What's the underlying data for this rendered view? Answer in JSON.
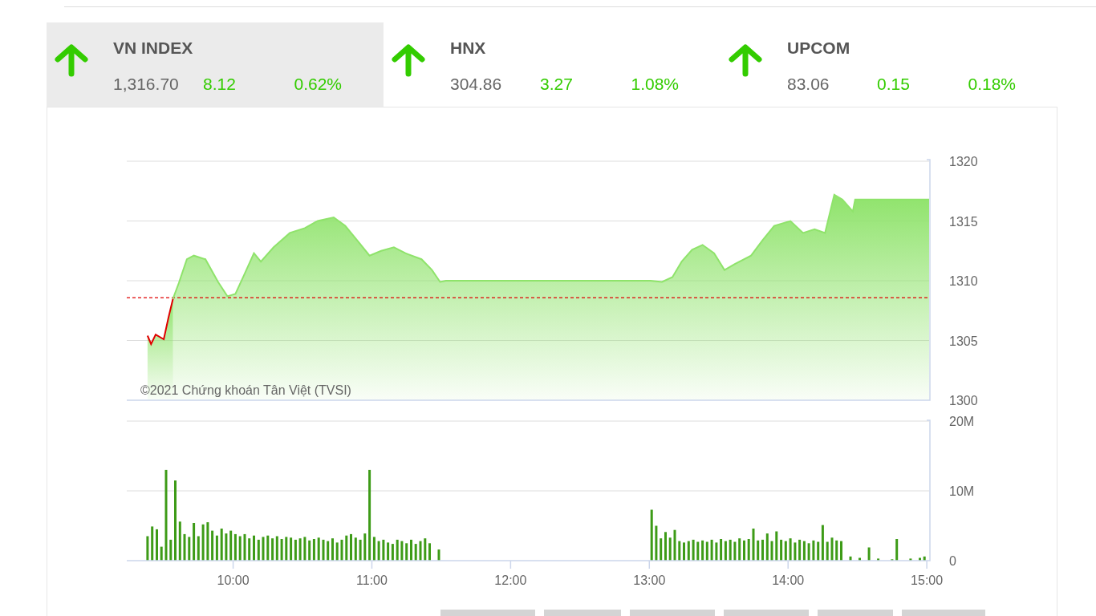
{
  "indices": [
    {
      "name": "VN INDEX",
      "value": "1,316.70",
      "change": "8.12",
      "percent": "0.62%",
      "kind": "up",
      "selected": true
    },
    {
      "name": "HNX",
      "value": "304.86",
      "change": "3.27",
      "percent": "1.08%",
      "kind": "up",
      "selected": false
    },
    {
      "name": "UPCOM",
      "value": "83.06",
      "change": "0.15",
      "percent": "0.18%",
      "kind": "up",
      "selected": false
    }
  ],
  "price_chart": {
    "copyright": "©2021 Chứng khoán Tân Việt (TVSI)",
    "chart_data": {
      "type": "area",
      "grid": true,
      "x": [
        563,
        564.5,
        566.5,
        570,
        572,
        574,
        576.5,
        580,
        583,
        588,
        593.5,
        597.5,
        601,
        605,
        609,
        612,
        617.5,
        624.5,
        631,
        636.5,
        643.5,
        648.5,
        654,
        659,
        664,
        669.5,
        674.5,
        681.5,
        686,
        689.5,
        692,
        780.5,
        785.5,
        790,
        794,
        798.5,
        803,
        808,
        812.5,
        817,
        824,
        829,
        834,
        841,
        846.5,
        851.5,
        856,
        860,
        863.5,
        868,
        869,
        901
      ],
      "series": [
        {
          "color": "#e00000",
          "values": [
            1305.4,
            1304.7,
            1305.5,
            1305.1,
            1306.9,
            1308.5,
            null,
            null,
            null,
            null,
            null,
            null,
            null,
            null,
            null,
            null,
            null,
            null,
            null,
            null,
            null,
            null,
            null,
            null,
            null,
            null,
            null,
            null,
            null,
            null,
            null,
            null,
            null,
            null,
            null,
            null,
            null,
            null,
            null,
            null,
            null,
            null,
            null,
            null,
            null,
            null,
            null,
            null,
            null,
            null,
            null,
            null
          ]
        },
        {
          "color": "#8fe36b",
          "values": [
            null,
            null,
            null,
            null,
            null,
            1308.5,
            1309.8,
            1311.8,
            1312.1,
            1311.8,
            1309.9,
            1308.7,
            1308.9,
            1310.6,
            1312.3,
            1311.6,
            1312.8,
            1314.0,
            1314.4,
            1315.0,
            1315.3,
            1314.6,
            1313.3,
            1312.1,
            1312.5,
            1312.8,
            1312.3,
            1311.8,
            1310.9,
            1309.9,
            1310.0,
            1310.0,
            1309.9,
            1310.3,
            1311.6,
            1312.6,
            1313.0,
            1312.3,
            1310.9,
            1311.4,
            1312.1,
            1313.4,
            1314.6,
            1315.0,
            1314.0,
            1314.3,
            1314.0,
            1317.2,
            1316.8,
            1315.8,
            1316.8,
            1316.8
          ]
        }
      ],
      "xlim": [
        554,
        901
      ],
      "ylim": [
        1300,
        1320
      ],
      "yticks": [
        1300,
        1305,
        1310,
        1315,
        1320
      ],
      "ref_lines": [
        {
          "axis": "y",
          "value": 1308.58,
          "color": "#e00000"
        }
      ]
    }
  },
  "volume_chart": {
    "chart_data": {
      "type": "bar",
      "x": [
        563,
        565,
        567,
        569,
        571,
        573,
        575,
        577,
        579,
        581,
        583,
        585,
        587,
        589,
        591,
        593,
        595,
        597,
        599,
        601,
        603,
        605,
        607,
        609,
        611,
        613,
        615,
        617,
        619,
        621,
        623,
        625,
        627,
        629,
        631,
        633,
        635,
        637,
        639,
        641,
        643,
        645,
        647,
        649,
        651,
        653,
        655,
        657,
        659,
        661,
        663,
        665,
        667,
        669,
        671,
        673,
        675,
        677,
        679,
        681,
        683,
        685,
        689,
        781,
        783,
        785,
        787,
        789,
        791,
        793,
        795,
        797,
        799,
        801,
        803,
        805,
        807,
        809,
        811,
        813,
        815,
        817,
        819,
        821,
        823,
        825,
        827,
        829,
        831,
        833,
        835,
        837,
        839,
        841,
        843,
        845,
        847,
        849,
        851,
        853,
        855,
        857,
        859,
        861,
        863,
        867,
        871,
        875,
        879,
        885,
        887,
        893,
        897,
        899
      ],
      "values": [
        3.5,
        4.9,
        4.5,
        2.0,
        13.0,
        3.0,
        11.5,
        5.6,
        3.8,
        3.4,
        5.4,
        3.5,
        5.2,
        5.5,
        4.3,
        3.6,
        4.6,
        3.9,
        4.3,
        3.8,
        3.5,
        3.8,
        3.2,
        3.6,
        3.0,
        3.4,
        3.6,
        3.2,
        3.5,
        3.1,
        3.4,
        3.3,
        3.0,
        3.2,
        3.4,
        2.9,
        3.1,
        3.3,
        3.0,
        2.8,
        3.2,
        2.6,
        3.0,
        3.6,
        3.8,
        3.3,
        3.0,
        3.9,
        13.0,
        3.4,
        2.8,
        3.0,
        2.6,
        2.4,
        3.0,
        2.8,
        2.5,
        3.0,
        2.4,
        2.8,
        3.2,
        2.5,
        1.6,
        7.3,
        5.0,
        3.2,
        4.1,
        3.3,
        4.4,
        2.8,
        2.6,
        2.8,
        3.0,
        2.7,
        2.9,
        2.7,
        3.0,
        2.6,
        3.1,
        2.8,
        3.0,
        2.7,
        3.2,
        2.9,
        3.1,
        4.6,
        2.9,
        3.0,
        3.9,
        2.8,
        4.2,
        3.0,
        2.8,
        3.2,
        2.6,
        3.0,
        2.8,
        2.5,
        2.9,
        2.7,
        5.1,
        2.7,
        3.3,
        2.9,
        2.8,
        0.6,
        0.4,
        1.9,
        0.3,
        0.2,
        3.1,
        0.3,
        0.4,
        0.6
      ],
      "xlim": [
        554,
        901
      ],
      "ylim": [
        0,
        20
      ],
      "yticks": [
        {
          "value": 0,
          "label": "0"
        },
        {
          "value": 10,
          "label": "10M"
        },
        {
          "value": 20,
          "label": "20M"
        }
      ],
      "xticks": [
        {
          "value": 600,
          "label": "10:00"
        },
        {
          "value": 660,
          "label": "11:00"
        },
        {
          "value": 720,
          "label": "12:00"
        },
        {
          "value": 780,
          "label": "13:00"
        },
        {
          "value": 840,
          "label": "14:00"
        },
        {
          "value": 900,
          "label": "15:00"
        }
      ]
    }
  }
}
